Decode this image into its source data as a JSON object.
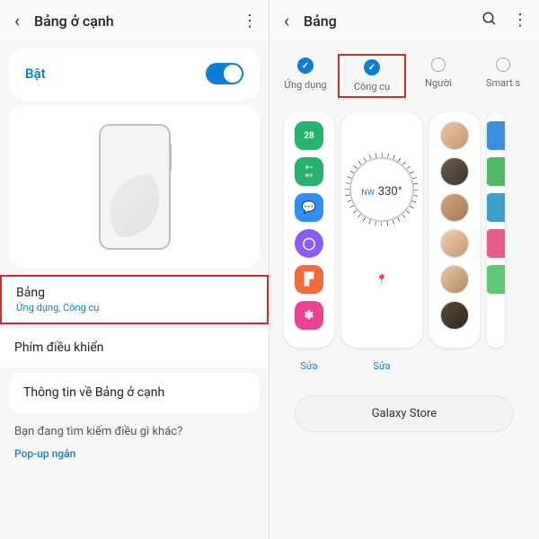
{
  "left": {
    "title": "Bảng ở cạnh",
    "enable_label": "Bật",
    "panels_title": "Bảng",
    "panels_sub": "Ứng dụng, Công cụ",
    "controls": "Phím điều khiển",
    "about": "Thông tin về Bảng ở cạnh",
    "question": "Bạn đang tìm kiếm điều gì khác?",
    "popup": "Pop-up ngắn"
  },
  "right": {
    "title": "Bảng",
    "tabs": {
      "apps": "Ứng dụng",
      "tools": "Công cụ",
      "people": "Người",
      "smart": "Smart s"
    },
    "compass_dir": "NW",
    "compass_deg": "330°",
    "edit": "Sửa",
    "store": "Galaxy Store"
  },
  "colors": {
    "accent": "#0e7dd6",
    "highlight": "#d42a2a",
    "app1": "#27b36f",
    "app2": "#27b36f",
    "app3": "#2e8ff7",
    "app4": "#8a5cf6",
    "app5": "#f26b3a",
    "app6": "#e9438f"
  }
}
